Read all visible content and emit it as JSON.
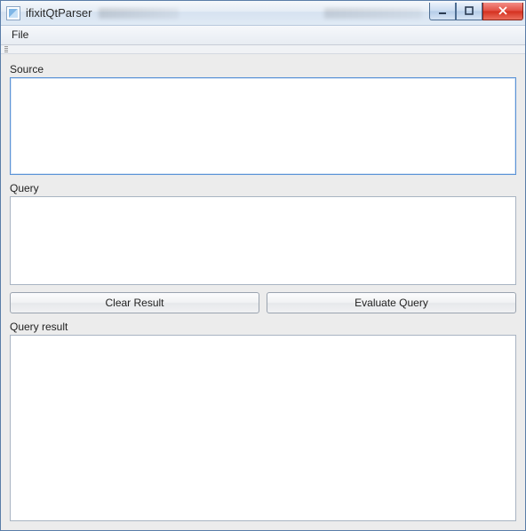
{
  "window": {
    "title": "ifixitQtParser"
  },
  "menubar": {
    "file": "File"
  },
  "labels": {
    "source": "Source",
    "query": "Query",
    "result": "Query result"
  },
  "buttons": {
    "clear": "Clear Result",
    "evaluate": "Evaluate Query"
  },
  "fields": {
    "source_value": "",
    "query_value": "",
    "result_value": ""
  }
}
